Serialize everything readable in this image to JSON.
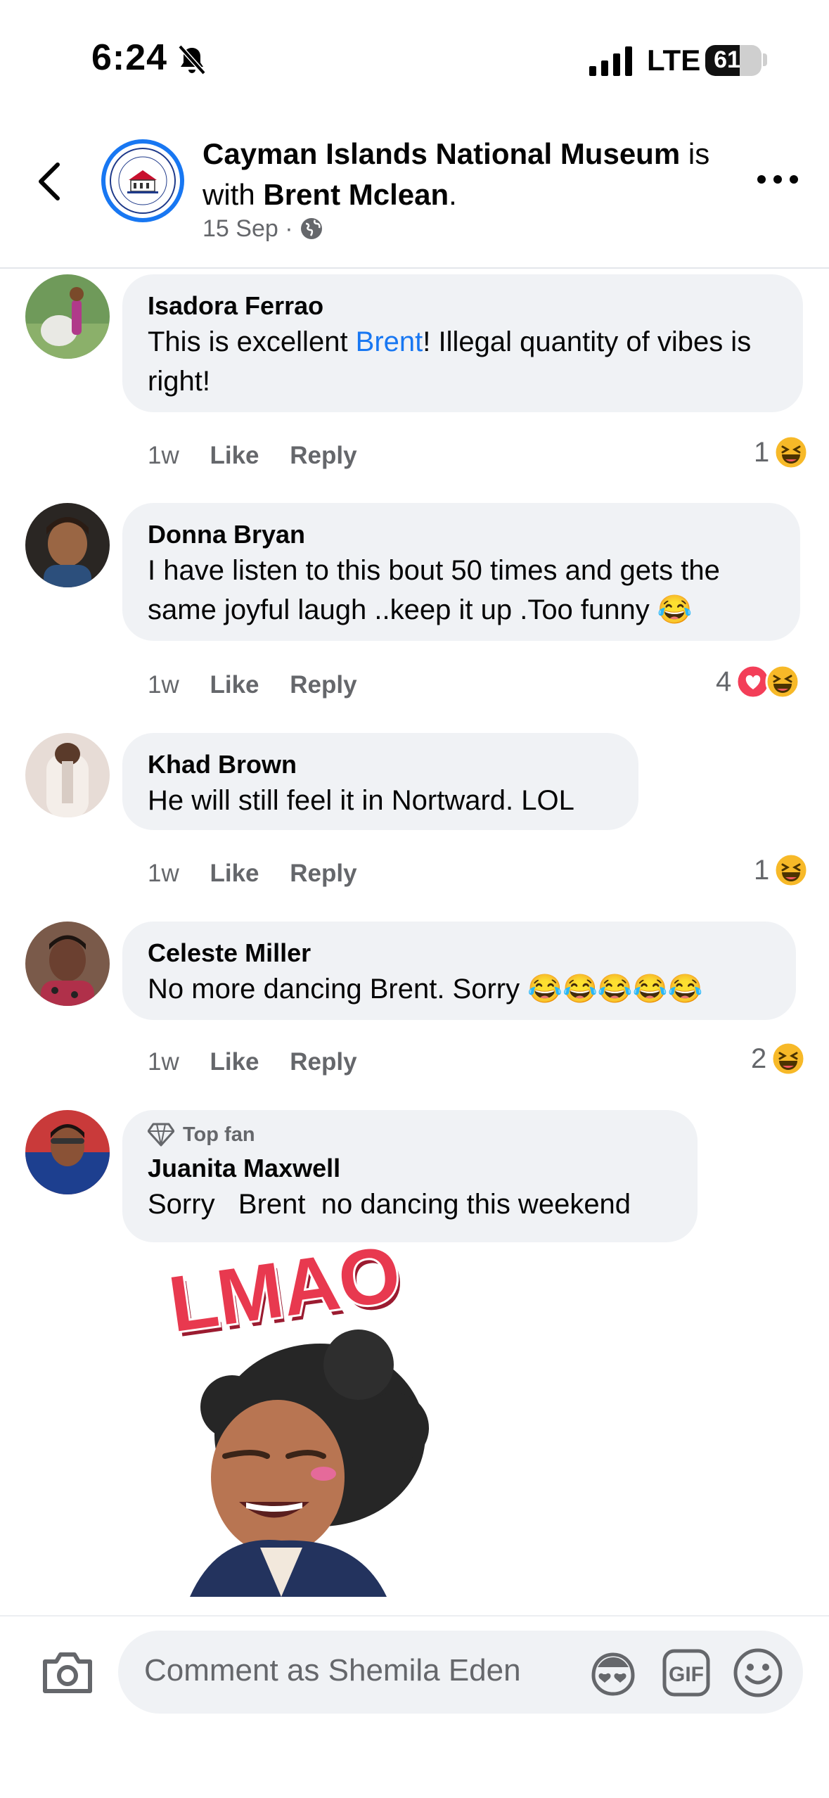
{
  "status_bar": {
    "time": "6:24",
    "network": "LTE",
    "battery": "61",
    "battery_level": 0.61
  },
  "header": {
    "page_name": "Cayman Islands National Museum",
    "with_text": "is with",
    "tagged_name": "Brent Mclean",
    "date": "15 Sep",
    "privacy_icon": "globe-icon"
  },
  "comments": [
    {
      "name": "Isadora Ferrao",
      "text_before": "This is excellent ",
      "mention": "Brent",
      "text_after": "! Illegal quantity of vibes is right!",
      "time": "1w",
      "like": "Like",
      "reply": "Reply",
      "reaction_count": "1",
      "reactions": [
        "haha"
      ]
    },
    {
      "name": "Donna Bryan",
      "text": "I have listen to this bout 50 times and gets the same joyful laugh ..keep it up .Too funny 😂",
      "time": "1w",
      "like": "Like",
      "reply": "Reply",
      "reaction_count": "4",
      "reactions": [
        "love",
        "haha"
      ]
    },
    {
      "name": "Khad Brown",
      "text": "He will still feel it in Nortward. LOL",
      "time": "1w",
      "like": "Like",
      "reply": "Reply",
      "reaction_count": "1",
      "reactions": [
        "haha"
      ]
    },
    {
      "name": "Celeste Miller",
      "text": "No more dancing Brent. Sorry 😂😂😂😂😂",
      "time": "1w",
      "like": "Like",
      "reply": "Reply",
      "reaction_count": "2",
      "reactions": [
        "haha"
      ]
    },
    {
      "badge": "Top fan",
      "name": "Juanita Maxwell",
      "text": "Sorry   Brent  no dancing this weekend",
      "sticker_text": "LMAO"
    }
  ],
  "composer": {
    "placeholder": "Comment as Shemila Eden",
    "gif_label": "GIF"
  },
  "colors": {
    "accent": "#1877f2",
    "bubble": "#f0f2f5",
    "meta": "#65676b"
  }
}
